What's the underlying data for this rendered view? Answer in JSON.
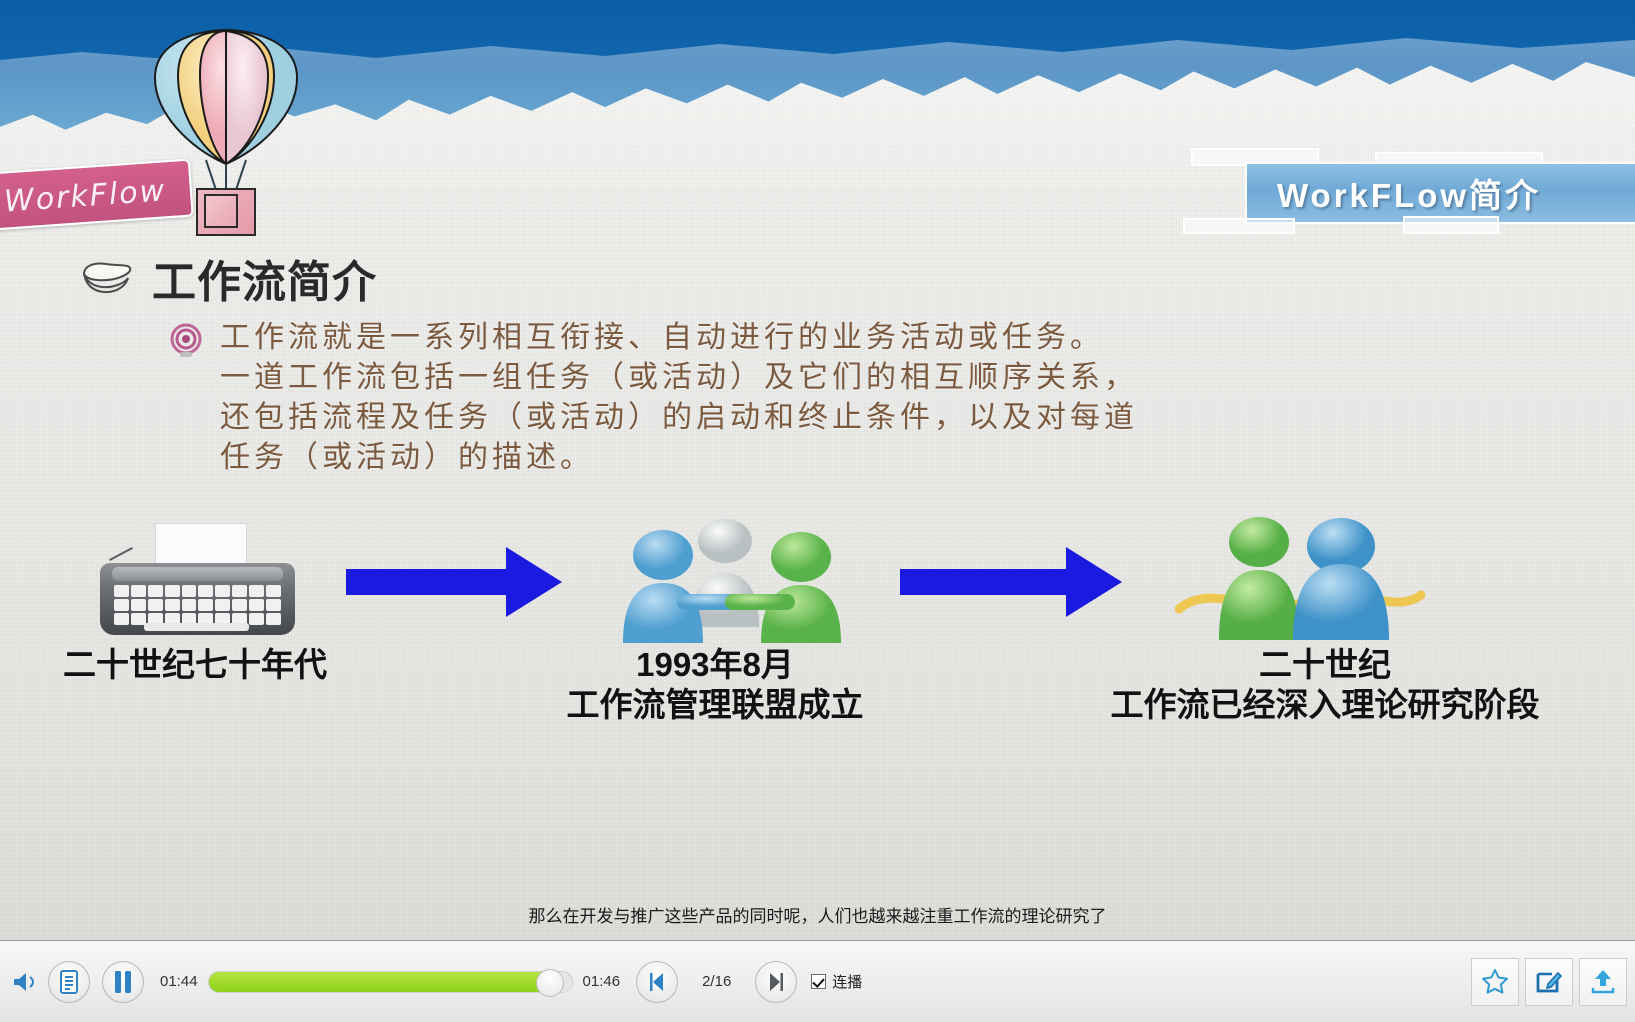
{
  "slide": {
    "top_left_banner": "WorkFlow",
    "top_right_title": "WorkFLow简介",
    "heading": "工作流简介",
    "bullet_icon": "target-icon",
    "paragraph_lines": [
      "工作流就是一系列相互衔接、自动进行的业务活动或任务。",
      "一道工作流包括一组任务（或活动）及它们的相互顺序关系，",
      "还包括流程及任务（或活动）的启动和终止条件，以及对每道",
      "任务（或活动）的描述。"
    ],
    "timeline": [
      {
        "icon": "typewriter-icon",
        "label_lines": [
          "二十世纪七十年代"
        ]
      },
      {
        "icon": "people-handshake-icon",
        "label_lines": [
          "1993年8月",
          "工作流管理联盟成立"
        ]
      },
      {
        "icon": "people-network-icon",
        "label_lines": [
          "二十世纪",
          "工作流已经深入理论研究阶段"
        ]
      }
    ],
    "arrow_color": "#1a1ae0",
    "body_text_color": "#7b5a3f",
    "accent_blue": "#6fa9d6",
    "accent_pink": "#c2527e"
  },
  "caption": "那么在开发与推广这些产品的同时呢，人们也越来越注重工作流的理论研究了",
  "player": {
    "volume_icon": "volume-icon",
    "notes_icon": "document-icon",
    "pause_icon": "pause-icon",
    "current_time": "01:44",
    "total_time": "01:46",
    "progress_percent": 94,
    "prev_icon": "previous-icon",
    "page_indicator": "2/16",
    "next_icon": "next-icon",
    "autoplay_label": "连播",
    "autoplay_checked": true,
    "favorite_icon": "star-icon",
    "note_edit_icon": "pencil-square-icon",
    "share_icon": "share-icon"
  }
}
